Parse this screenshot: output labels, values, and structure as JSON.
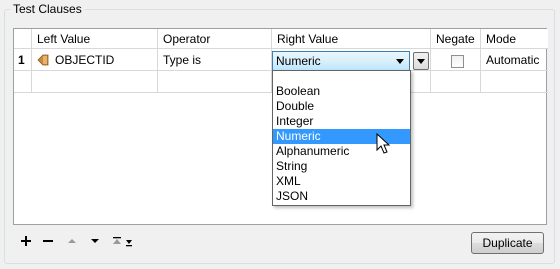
{
  "group": {
    "title": "Test Clauses"
  },
  "table": {
    "headers": [
      "Left Value",
      "Operator",
      "Right Value",
      "Negate",
      "Mode"
    ],
    "rows": [
      {
        "number": "1",
        "left_value": "OBJECTID",
        "operator": "Type is",
        "right_value": "Numeric",
        "negate": false,
        "mode": "Automatic"
      }
    ]
  },
  "dropdown": {
    "options": [
      "",
      "Boolean",
      "Double",
      "Integer",
      "Numeric",
      "Alphanumeric",
      "String",
      "XML",
      "JSON"
    ],
    "selected": "Numeric"
  },
  "toolbar": {
    "icons": [
      "add-icon",
      "remove-icon",
      "move-up-icon",
      "move-down-icon",
      "move-top-bottom-icon"
    ],
    "duplicate_label": "Duplicate"
  },
  "colors": {
    "selection": "#3399ff",
    "combo_border": "#3c7fb1",
    "attribute_icon": "#c98a3c"
  }
}
